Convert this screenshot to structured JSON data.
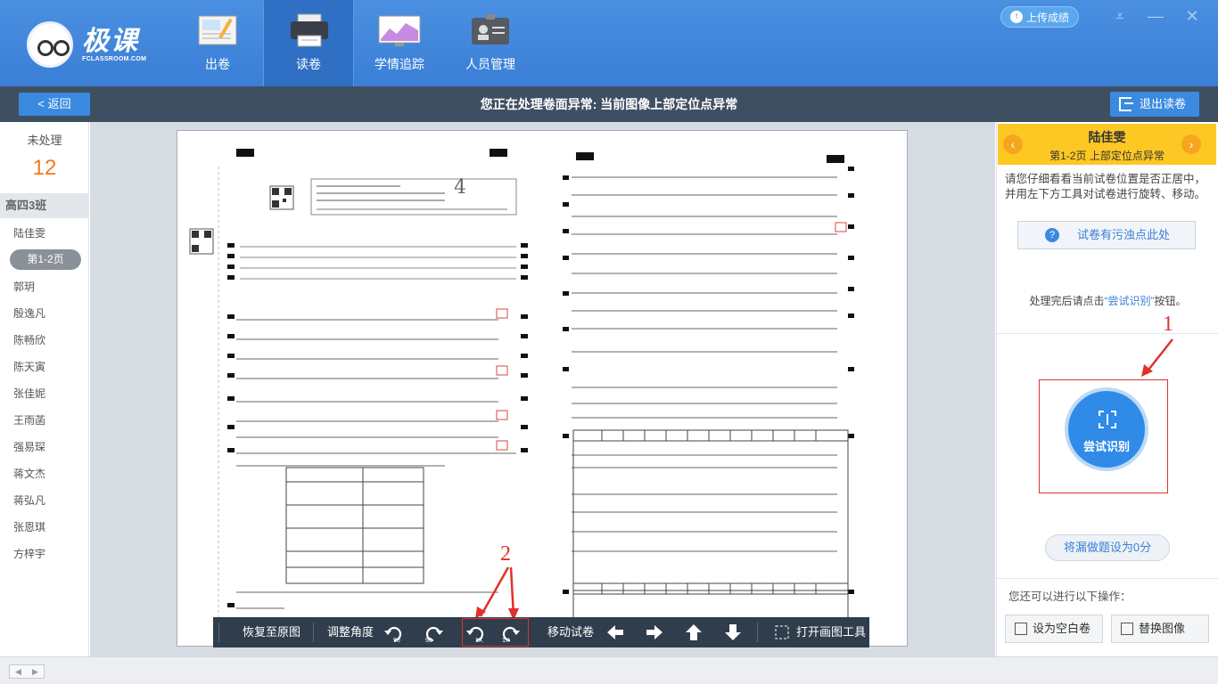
{
  "app": {
    "logo_text": "极课",
    "logo_sub": "FCLASSROOM.COM"
  },
  "nav": {
    "items": [
      {
        "label": "出卷",
        "icon": "exam-paper-icon"
      },
      {
        "label": "读卷",
        "icon": "printer-icon"
      },
      {
        "label": "学情追踪",
        "icon": "chart-monitor-icon"
      },
      {
        "label": "人员管理",
        "icon": "id-card-icon"
      }
    ],
    "active": "读卷"
  },
  "header": {
    "upload_label": "上传成绩",
    "window_controls": [
      "collapse-icon",
      "minimize-icon",
      "close-icon"
    ]
  },
  "subbar": {
    "back_label": "< 返回",
    "title": "您正在处理卷面异常: 当前图像上部定位点异常",
    "exit_label": "退出读卷"
  },
  "sidebar": {
    "pending_label": "未处理",
    "pending_count": "12",
    "class_name": "高四3班",
    "students_top": [
      "陆佳雯"
    ],
    "selected_page": "第1-2页",
    "students_rest": [
      "郭玥",
      "殷逸凡",
      "陈畅欣",
      "陈天寅",
      "张佳妮",
      "王雨菡",
      "强易琛",
      "蒋文杰",
      "蒋弘凡",
      "张恩琪",
      "方梓宇"
    ]
  },
  "toolbar": {
    "restore_label": "恢复至原图",
    "adjust_angle_label": "调整角度",
    "rotate_labels": [
      "90",
      "90",
      "1X",
      "1X"
    ],
    "move_label": "移动试卷",
    "draw_tool_label": "打开画图工具"
  },
  "right_panel": {
    "student_name": "陆佳雯",
    "status": "第1-2页    上部定位点异常",
    "description": "请您仔细看看当前试卷位置是否正居中，并用左下方工具对试卷进行旋转、移动。",
    "dirty_button": "试卷有污浊点此处",
    "hint_prefix": "处理完后请点击",
    "hint_link": "“尝试识别”",
    "hint_suffix": "按钮。",
    "recognize_label": "尝试识别",
    "zero_button": "将漏做题设为0分",
    "more_label": "您还可以进行以下操作：",
    "blank_button": "设为空白卷",
    "replace_button": "替换图像"
  },
  "annotations": {
    "one": "1",
    "two": "2"
  },
  "colors": {
    "header_blue": "#3a7fd6",
    "accent_orange": "#f0781e",
    "highlight_yellow": "#fdc823",
    "annotation_red": "#e0322a"
  }
}
